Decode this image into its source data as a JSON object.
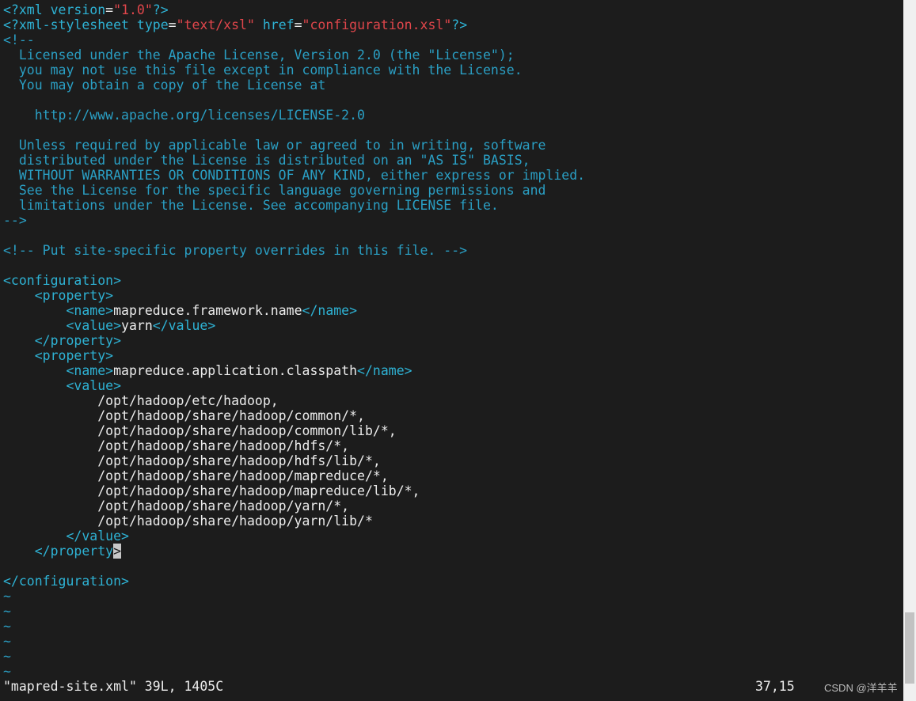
{
  "editor": {
    "lines": [
      [
        [
          "pi",
          "<?"
        ],
        [
          "tag",
          "xml "
        ],
        [
          "attr",
          "version"
        ],
        [
          "eq",
          "="
        ],
        [
          "str",
          "\"1.0\""
        ],
        [
          "pi",
          "?>"
        ]
      ],
      [
        [
          "pi",
          "<?"
        ],
        [
          "tag",
          "xml-stylesheet "
        ],
        [
          "attr",
          "type"
        ],
        [
          "eq",
          "="
        ],
        [
          "str",
          "\"text/xsl\""
        ],
        [
          "txt",
          " "
        ],
        [
          "attr",
          "href"
        ],
        [
          "eq",
          "="
        ],
        [
          "str",
          "\"configuration.xsl\""
        ],
        [
          "pi",
          "?>"
        ]
      ],
      [
        [
          "cmt",
          "<!--"
        ]
      ],
      [
        [
          "cmt",
          "  Licensed under the Apache License, Version 2.0 (the \"License\");"
        ]
      ],
      [
        [
          "cmt",
          "  you may not use this file except in compliance with the License."
        ]
      ],
      [
        [
          "cmt",
          "  You may obtain a copy of the License at"
        ]
      ],
      [
        [
          "cmt",
          ""
        ]
      ],
      [
        [
          "cmt",
          "    http://www.apache.org/licenses/LICENSE-2.0"
        ]
      ],
      [
        [
          "cmt",
          ""
        ]
      ],
      [
        [
          "cmt",
          "  Unless required by applicable law or agreed to in writing, software"
        ]
      ],
      [
        [
          "cmt",
          "  distributed under the License is distributed on an \"AS IS\" BASIS,"
        ]
      ],
      [
        [
          "cmt",
          "  WITHOUT WARRANTIES OR CONDITIONS OF ANY KIND, either express or implied."
        ]
      ],
      [
        [
          "cmt",
          "  See the License for the specific language governing permissions and"
        ]
      ],
      [
        [
          "cmt",
          "  limitations under the License. See accompanying LICENSE file."
        ]
      ],
      [
        [
          "cmt",
          "-->"
        ]
      ],
      [
        [
          "txt",
          ""
        ]
      ],
      [
        [
          "cmt",
          "<!-- Put site-specific property overrides in this file. -->"
        ]
      ],
      [
        [
          "txt",
          ""
        ]
      ],
      [
        [
          "tag",
          "<configuration>"
        ]
      ],
      [
        [
          "txt",
          "    "
        ],
        [
          "tag",
          "<property>"
        ]
      ],
      [
        [
          "txt",
          "        "
        ],
        [
          "tag",
          "<name>"
        ],
        [
          "txt",
          "mapreduce.framework.name"
        ],
        [
          "tag",
          "</name>"
        ]
      ],
      [
        [
          "txt",
          "        "
        ],
        [
          "tag",
          "<value>"
        ],
        [
          "txt",
          "yarn"
        ],
        [
          "tag",
          "</value>"
        ]
      ],
      [
        [
          "txt",
          "    "
        ],
        [
          "tag",
          "</property>"
        ]
      ],
      [
        [
          "txt",
          "    "
        ],
        [
          "tag",
          "<property>"
        ]
      ],
      [
        [
          "txt",
          "        "
        ],
        [
          "tag",
          "<name>"
        ],
        [
          "txt",
          "mapreduce.application.classpath"
        ],
        [
          "tag",
          "</name>"
        ]
      ],
      [
        [
          "txt",
          "        "
        ],
        [
          "tag",
          "<value>"
        ]
      ],
      [
        [
          "txt",
          "            /opt/hadoop/etc/hadoop,"
        ]
      ],
      [
        [
          "txt",
          "            /opt/hadoop/share/hadoop/common/*,"
        ]
      ],
      [
        [
          "txt",
          "            /opt/hadoop/share/hadoop/common/lib/*,"
        ]
      ],
      [
        [
          "txt",
          "            /opt/hadoop/share/hadoop/hdfs/*,"
        ]
      ],
      [
        [
          "txt",
          "            /opt/hadoop/share/hadoop/hdfs/lib/*,"
        ]
      ],
      [
        [
          "txt",
          "            /opt/hadoop/share/hadoop/mapreduce/*,"
        ]
      ],
      [
        [
          "txt",
          "            /opt/hadoop/share/hadoop/mapreduce/lib/*,"
        ]
      ],
      [
        [
          "txt",
          "            /opt/hadoop/share/hadoop/yarn/*,"
        ]
      ],
      [
        [
          "txt",
          "            /opt/hadoop/share/hadoop/yarn/lib/*"
        ]
      ],
      [
        [
          "txt",
          "        "
        ],
        [
          "tag",
          "</value>"
        ]
      ],
      [
        [
          "txt",
          "    "
        ],
        [
          "tag",
          "</property"
        ],
        [
          "cursor",
          ">"
        ]
      ],
      [
        [
          "txt",
          ""
        ]
      ],
      [
        [
          "tag",
          "</configuration>"
        ]
      ],
      [
        [
          "tilde",
          "~"
        ]
      ],
      [
        [
          "tilde",
          "~"
        ]
      ],
      [
        [
          "tilde",
          "~"
        ]
      ],
      [
        [
          "tilde",
          "~"
        ]
      ],
      [
        [
          "tilde",
          "~"
        ]
      ],
      [
        [
          "tilde",
          "~"
        ]
      ]
    ]
  },
  "statusbar": {
    "file_info": "\"mapred-site.xml\" 39L, 1405C",
    "cursor_position": "37,15"
  },
  "watermark": {
    "text": "CSDN @洋羊羊"
  },
  "colors": {
    "background": "#1c1c1c",
    "tag": "#2eb2d4",
    "string": "#e0464b",
    "comment": "#2a9fc4",
    "text": "#ececec"
  }
}
